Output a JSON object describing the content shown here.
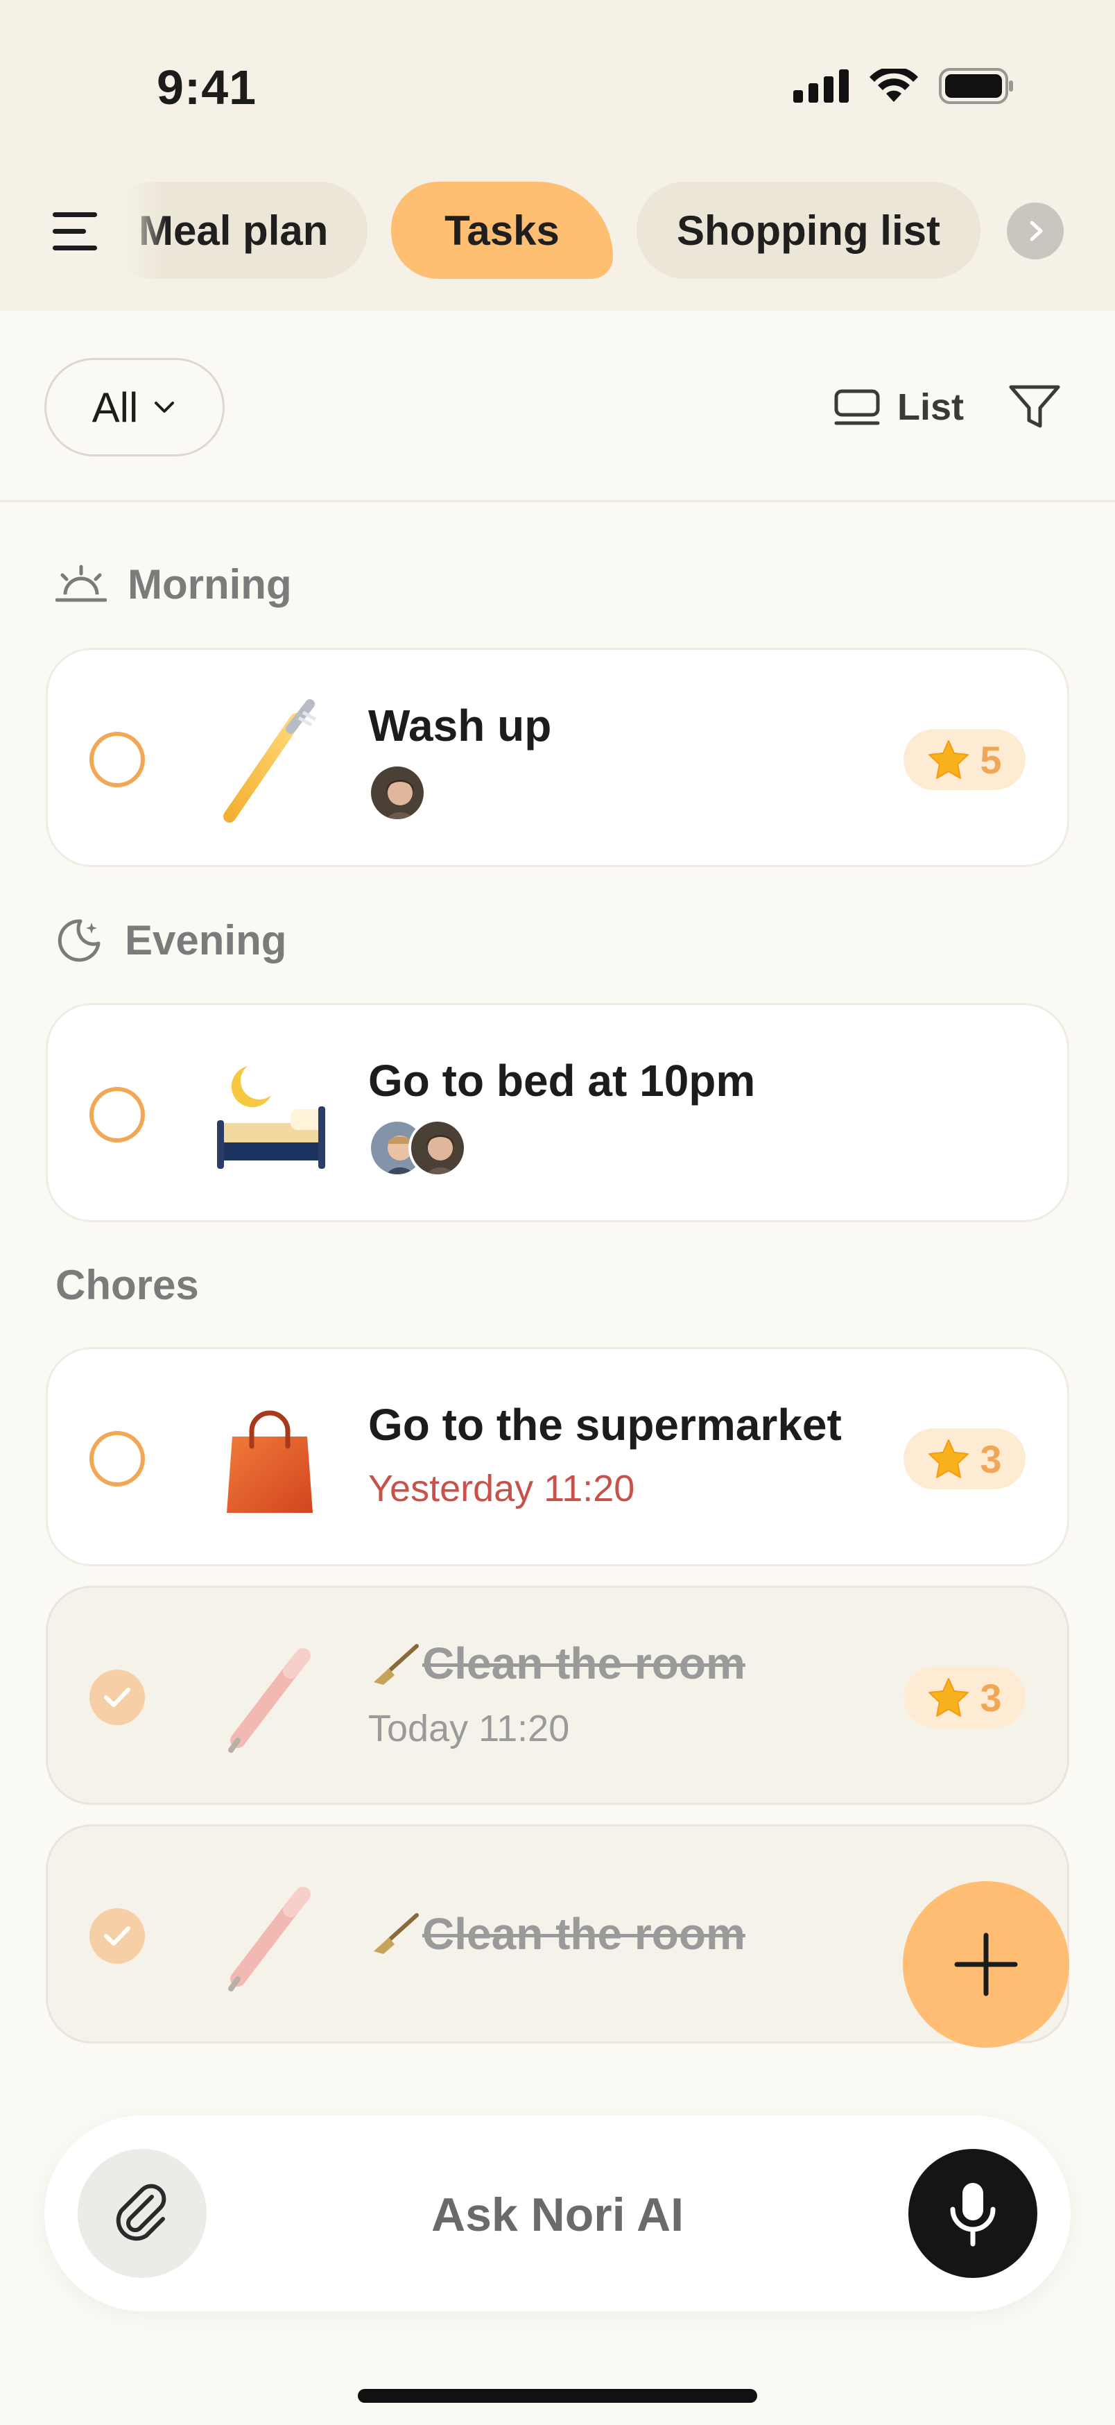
{
  "status_bar": {
    "time": "9:41"
  },
  "tabs": [
    {
      "label": "Meal plan",
      "active": false
    },
    {
      "label": "Tasks",
      "active": true
    },
    {
      "label": "Shopping list",
      "active": false
    }
  ],
  "toolbar": {
    "filter_label": "All",
    "view_label": "List"
  },
  "sections": {
    "morning": "Morning",
    "evening": "Evening",
    "chores": "Chores"
  },
  "tasks": [
    {
      "title": "Wash up",
      "points": "5",
      "done": false,
      "icon": "toothbrush-icon"
    },
    {
      "title": "Go to bed at 10pm",
      "done": false,
      "icon": "bed-moon-icon"
    },
    {
      "title": "Go to the supermarket",
      "subtitle": "Yesterday 11:20",
      "points": "3",
      "done": false,
      "icon": "shopping-bag-icon"
    },
    {
      "title": "Clean the room",
      "subtitle": "Today 11:20",
      "points": "3",
      "done": true,
      "icon": "pencil-icon"
    },
    {
      "title": "Clean the room",
      "done": true,
      "icon": "pencil-icon"
    }
  ],
  "ask_bar": {
    "label": "Ask Nori AI"
  },
  "colors": {
    "accent": "#FFBF73",
    "check_border": "#F2A756",
    "overdue": "#C8524A",
    "header_bg": "#F5F1E7"
  }
}
